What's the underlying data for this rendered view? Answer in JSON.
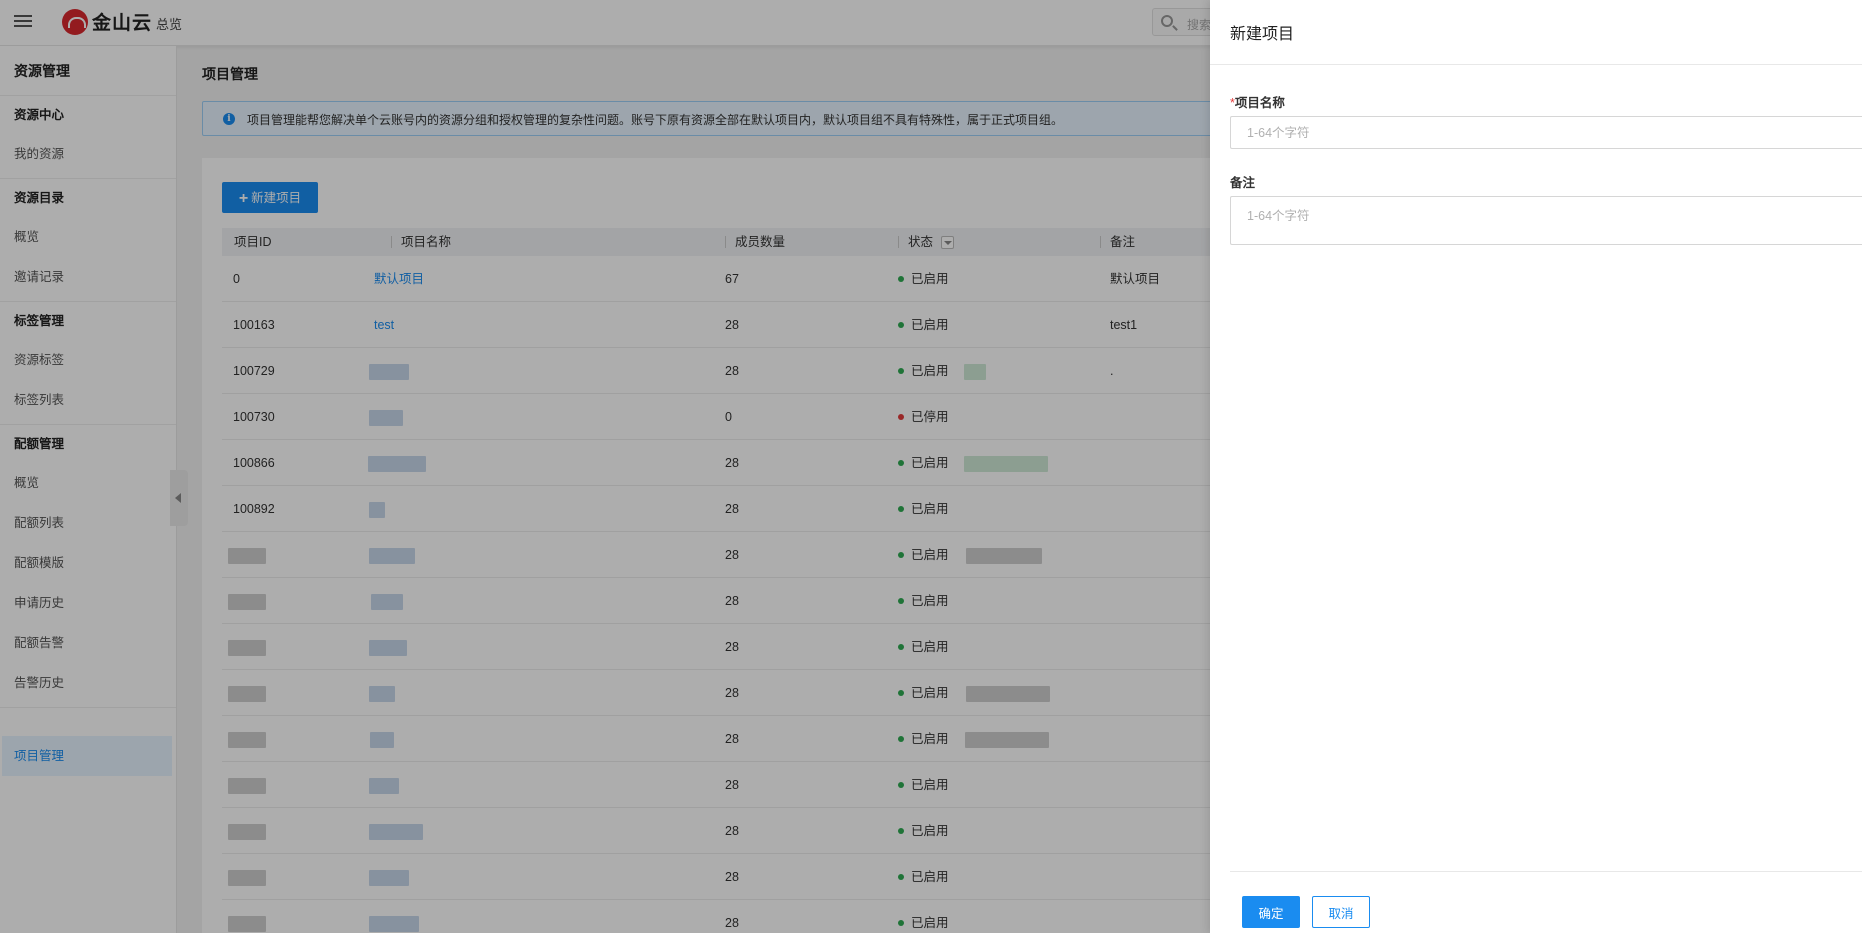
{
  "topbar": {
    "logo_text": "金山云",
    "nav_overview": "总览",
    "search_placeholder": "搜索"
  },
  "sidebar": {
    "title": "资源管理",
    "groups": [
      {
        "label": "资源中心",
        "items": [
          "我的资源"
        ]
      },
      {
        "label": "资源目录",
        "items": [
          "概览",
          "邀请记录"
        ]
      },
      {
        "label": "标签管理",
        "items": [
          "资源标签",
          "标签列表"
        ]
      },
      {
        "label": "配额管理",
        "items": [
          "概览",
          "配额列表",
          "配额模版",
          "申请历史",
          "配额告警",
          "告警历史"
        ]
      }
    ],
    "active_item": "项目管理"
  },
  "main": {
    "page_title": "项目管理",
    "notice": "项目管理能帮您解决单个云账号内的资源分组和授权管理的复杂性问题。账号下原有资源全部在默认项目内，默认项目组不具有特殊性，属于正式项目组。",
    "new_button_label": "新建项目",
    "columns": [
      "项目ID",
      "项目名称",
      "成员数量",
      "状态",
      "备注"
    ],
    "rows": [
      {
        "id": "0",
        "name": "默认项目",
        "members": "67",
        "status": "已启用",
        "status_color": "#2eaa52",
        "note": "默认项目"
      },
      {
        "id": "100163",
        "name": "test",
        "members": "28",
        "status": "已启用",
        "status_color": "#2eaa52",
        "note": "test1"
      },
      {
        "id": "100729",
        "name": "",
        "members": "28",
        "status": "已启用",
        "status_color": "#2eaa52",
        "note": "."
      },
      {
        "id": "100730",
        "name": "",
        "members": "0",
        "status": "已停用",
        "status_color": "#e23c3c",
        "note": ""
      },
      {
        "id": "100866",
        "name": "",
        "members": "28",
        "status": "已启用",
        "status_color": "#2eaa52",
        "note": ""
      },
      {
        "id": "100892",
        "name": "",
        "members": "28",
        "status": "已启用",
        "status_color": "#2eaa52",
        "note": ""
      },
      {
        "id": "",
        "name": "",
        "members": "28",
        "status": "已启用",
        "status_color": "#2eaa52",
        "note": ""
      },
      {
        "id": "",
        "name": "",
        "members": "28",
        "status": "已启用",
        "status_color": "#2eaa52",
        "note": ""
      },
      {
        "id": "",
        "name": "",
        "members": "28",
        "status": "已启用",
        "status_color": "#2eaa52",
        "note": ""
      },
      {
        "id": "",
        "name": "",
        "members": "28",
        "status": "已启用",
        "status_color": "#2eaa52",
        "note": ""
      },
      {
        "id": "",
        "name": "",
        "members": "28",
        "status": "已启用",
        "status_color": "#2eaa52",
        "note": ""
      },
      {
        "id": "",
        "name": "",
        "members": "28",
        "status": "已启用",
        "status_color": "#2eaa52",
        "note": ""
      },
      {
        "id": "",
        "name": "",
        "members": "28",
        "status": "已启用",
        "status_color": "#2eaa52",
        "note": ""
      },
      {
        "id": "",
        "name": "",
        "members": "28",
        "status": "已启用",
        "status_color": "#2eaa52",
        "note": ""
      },
      {
        "id": "",
        "name": "",
        "members": "28",
        "status": "已启用",
        "status_color": "#2eaa52",
        "note": ""
      }
    ]
  },
  "drawer": {
    "title": "新建项目",
    "name_required_mark": "*",
    "name_label": "项目名称",
    "name_placeholder": "1-64个字符",
    "note_label": "备注",
    "note_placeholder": "1-64个字符",
    "ok_label": "确定",
    "cancel_label": "取消"
  },
  "colors": {
    "accent": "#1a8cf0",
    "brand": "#d9282f",
    "enabled": "#2eaa52",
    "disabled": "#e23c3c"
  }
}
